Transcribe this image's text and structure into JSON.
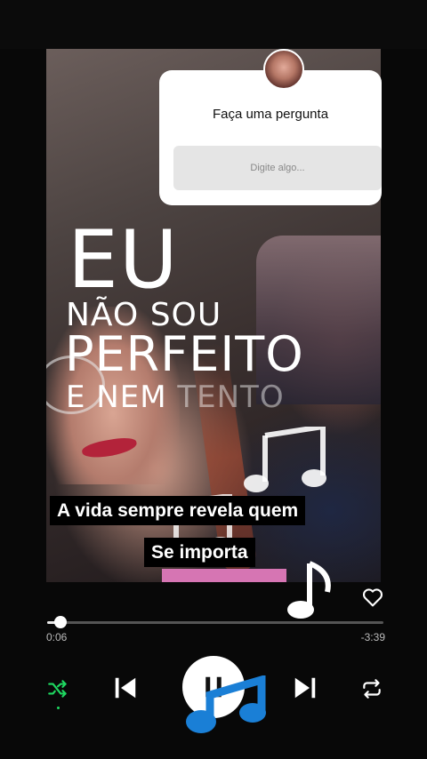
{
  "story": {
    "question_box": {
      "title": "Faça uma pergunta",
      "placeholder": "Digite algo..."
    },
    "overlay_text": {
      "line1": "EU",
      "line2": "NÃO SOU",
      "line3": "PERFEITO",
      "line4a": "E NEM ",
      "line4b": "TENTO"
    },
    "captions": {
      "line1": "A vida sempre revela quem",
      "line2": "Se importa"
    },
    "decorations": [
      "music-note-icon",
      "music-note-icon",
      "music-note-icon"
    ]
  },
  "player": {
    "elapsed": "0:06",
    "remaining": "-3:39",
    "progress_fraction": 0.04,
    "liked": false,
    "is_playing": true,
    "shuffle_active": true,
    "accent_color": "#1ed760",
    "icons": [
      "heart-icon",
      "shuffle-icon",
      "previous-icon",
      "pause-icon",
      "next-icon",
      "repeat-icon"
    ]
  }
}
